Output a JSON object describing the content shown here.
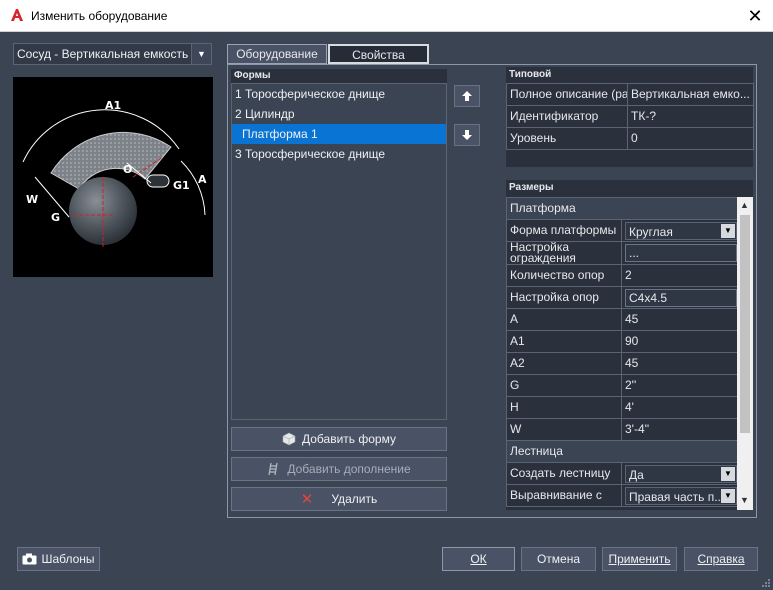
{
  "window": {
    "title": "Изменить оборудование"
  },
  "equipment_type": {
    "selected": "Сосуд - Вертикальная емкость"
  },
  "diagram": {
    "labels": [
      "A1",
      "O",
      "W",
      "G1",
      "A",
      "G"
    ]
  },
  "tabs": [
    {
      "label": "Оборудование",
      "active": true
    },
    {
      "label": "Свойства",
      "active": false
    }
  ],
  "shapes": {
    "header": "Формы",
    "items": [
      {
        "label": "1 Торосферическое днище",
        "selected": false
      },
      {
        "label": "2 Цилиндр",
        "selected": false
      },
      {
        "label": "Платформа 1",
        "selected": true
      },
      {
        "label": "3 Торосферическое днище",
        "selected": false
      }
    ]
  },
  "actions": {
    "add_shape": "Добавить форму",
    "add_addon": "Добавить дополнение",
    "delete": "Удалить"
  },
  "typical": {
    "header": "Типовой",
    "rows": [
      {
        "name": "Полное описание (размер)",
        "value": "Вертикальная емко..."
      },
      {
        "name": "Идентификатор",
        "value": "ТК-?"
      },
      {
        "name": "Уровень",
        "value": "0"
      }
    ]
  },
  "dimensions": {
    "header": "Размеры",
    "platform_group": "Платформа",
    "platform_rows": [
      {
        "name": "Форма платформы",
        "value": "Круглая"
      },
      {
        "name": "Настройка ограждения",
        "value": "..."
      },
      {
        "name": "Количество опор",
        "value": "2"
      },
      {
        "name": "Настройка опор",
        "value": "C4x4.5"
      },
      {
        "name": "A",
        "value": "45"
      },
      {
        "name": "A1",
        "value": "90"
      },
      {
        "name": "A2",
        "value": "45"
      },
      {
        "name": "G",
        "value": "2''"
      },
      {
        "name": "H",
        "value": "4'"
      },
      {
        "name": "W",
        "value": "3'-4''"
      }
    ],
    "ladder_group": "Лестница",
    "ladder_rows": [
      {
        "name": "Создать лестницу",
        "value": "Да"
      },
      {
        "name": "Выравнивание с",
        "value": "Правая часть п..."
      }
    ]
  },
  "footer": {
    "templates": "Шаблоны",
    "ok": "ОК",
    "cancel": "Отмена",
    "apply": "Применить",
    "help": "Справка"
  },
  "colors": {
    "background": "#3b4453",
    "selection": "#0a74d4",
    "delete_icon": "#e0453d"
  }
}
